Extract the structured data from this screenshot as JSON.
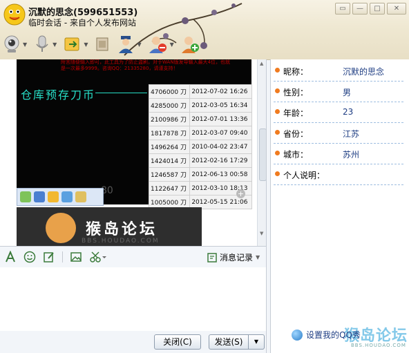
{
  "window": {
    "contact_name": "沉默的思念(599651553)",
    "session_info": "临时会话 - 来自个人发布网站"
  },
  "colors": {
    "accent": "#f07b1f",
    "link": "#1d3c82",
    "header_bg": "#efe8d2"
  },
  "toolbar": {
    "icons": [
      "webcam-icon",
      "microphone-icon",
      "send-file-icon",
      "message-box-icon",
      "user-agent-icon",
      "remove-contact-icon",
      "add-contact-icon"
    ]
  },
  "chat": {
    "screenshot_red_text": "附言随便输入即可，此工具为了防止盗刷，对于WAN版发导输入最大4位，也就是一次最多9999。咨询QQ：21335280，请谨支持！",
    "screenshot_title": "仓库预存刀币",
    "screenshot_number": "80",
    "table_rows": [
      {
        "amount": "4706000 刀",
        "time": "2012-07-02 16:26"
      },
      {
        "amount": "4285000 刀",
        "time": "2012-03-05 16:34"
      },
      {
        "amount": "2100986 刀",
        "time": "2012-07-01 13:36"
      },
      {
        "amount": "1817878 刀",
        "time": "2012-03-07 09:40"
      },
      {
        "amount": "1496264 刀",
        "time": "2010-04-02 23:47"
      },
      {
        "amount": "1424014 刀",
        "time": "2012-02-16 17:29"
      },
      {
        "amount": "1246587 刀",
        "time": "2012-06-13 00:58"
      },
      {
        "amount": "1122647 刀",
        "time": "2012-03-10 18:13"
      },
      {
        "amount": "1005000 刀",
        "time": "2012-05-15 21:06"
      }
    ],
    "banner_text": "猴岛论坛",
    "banner_url": "BBS.HOUDAO.COM"
  },
  "input_toolbar": {
    "history_label": "消息记录"
  },
  "buttons": {
    "close": "关闭(C)",
    "send": "发送(S)"
  },
  "profile": {
    "fields": [
      {
        "label": "昵称：",
        "value": "沉默的思念"
      },
      {
        "label": "性别：",
        "value": "男"
      },
      {
        "label": "年龄：",
        "value": "23"
      },
      {
        "label": "省份：",
        "value": "江苏"
      },
      {
        "label": "城市：",
        "value": "苏州"
      },
      {
        "label": "个人说明：",
        "value": ""
      }
    ],
    "set_show": "设置我的QQ秀",
    "watermark": "猴岛论坛",
    "watermark_url": "BBS.HOUDAO.COM"
  }
}
